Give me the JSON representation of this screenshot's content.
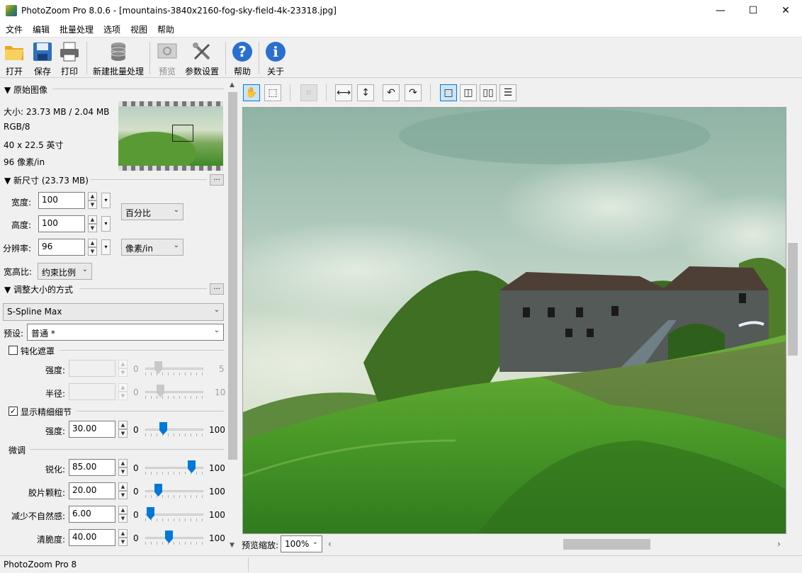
{
  "window": {
    "title": "PhotoZoom Pro 8.0.6 - [mountains-3840x2160-fog-sky-field-4k-23318.jpg]",
    "minimize": "—",
    "maximize": "☐",
    "close": "✕"
  },
  "menu": [
    "文件",
    "编辑",
    "批量处理",
    "选项",
    "视图",
    "帮助"
  ],
  "toolbar": {
    "open": "打开",
    "save": "保存",
    "print": "打印",
    "new_batch": "新建批量处理",
    "preview": "预览",
    "settings": "参数设置",
    "help": "帮助",
    "about": "关于"
  },
  "original": {
    "header": "▼ 原始图像",
    "size": "大小: 23.73 MB / 2.04 MB",
    "color": "RGB/8",
    "dimensions": "40 x 22.5 英寸",
    "resolution": "96 像素/in"
  },
  "new_size": {
    "header": "▼ 新尺寸 (23.73 MB)",
    "dots": "...",
    "width_label": "宽度:",
    "width_value": "100",
    "height_label": "高度:",
    "height_value": "100",
    "resolution_label": "分辨率:",
    "resolution_value": "96",
    "unit_size": "百分比",
    "unit_res": "像素/in",
    "aspect_label": "宽高比:",
    "aspect_value": "约束比例"
  },
  "resize": {
    "header": "▼ 调整大小的方式",
    "dots": "...",
    "method": "S-Spline Max",
    "preset_label": "预设:",
    "preset_value": "普通 *"
  },
  "unsharp": {
    "label": "钝化遮罩",
    "checked": false,
    "strength_label": "强度:",
    "strength_min": "0",
    "strength_max": "5",
    "radius_label": "半径:",
    "radius_min": "0",
    "radius_max": "10"
  },
  "detail": {
    "label": "显示精细细节",
    "checked": true,
    "strength_label": "强度:",
    "strength_value": "30.00",
    "min": "0",
    "max": "100",
    "level": 0.3
  },
  "finetune": {
    "header": "微调",
    "rows": [
      {
        "label": "锐化:",
        "value": "85.00",
        "min": "0",
        "max": "100",
        "level": 0.85
      },
      {
        "label": "胶片颗粒:",
        "value": "20.00",
        "min": "0",
        "max": "100",
        "level": 0.2
      },
      {
        "label": "减少不自然感:",
        "value": "6.00",
        "min": "0",
        "max": "100",
        "level": 0.06
      },
      {
        "label": "清脆度:",
        "value": "40.00",
        "min": "0",
        "max": "100",
        "level": 0.4
      }
    ]
  },
  "preview_zoom": {
    "label": "预览缩放:",
    "value": "100%"
  },
  "status": "PhotoZoom Pro 8",
  "colors": {
    "accent": "#0078d7",
    "sky": "#a8c9c0",
    "grass": "#4e9a2c"
  }
}
